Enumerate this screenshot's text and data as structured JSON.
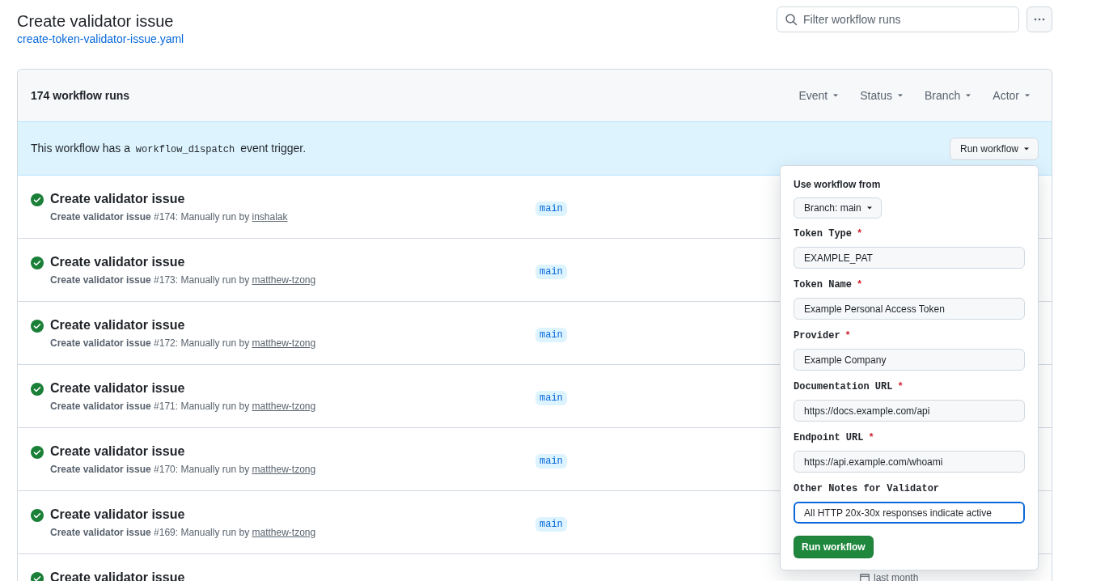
{
  "page": {
    "title": "Create validator issue",
    "file_link": "create-token-validator-issue.yaml",
    "filter": {
      "placeholder": "Filter workflow runs"
    }
  },
  "runs_box": {
    "count": "174 workflow runs",
    "filters": [
      "Event",
      "Status",
      "Branch",
      "Actor"
    ],
    "banner": {
      "before": "This workflow has a",
      "code": "workflow_dispatch",
      "after": "event trigger.",
      "button": "Run workflow"
    },
    "runs": [
      {
        "succeeded": true,
        "title": "Create validator issue",
        "workflow": "Create validator issue",
        "number": "#174: Manually run by",
        "actor": "inshalak",
        "branch": "main"
      },
      {
        "succeeded": true,
        "title": "Create validator issue",
        "workflow": "Create validator issue",
        "number": "#173: Manually run by",
        "actor": "matthew-tzong",
        "branch": "main"
      },
      {
        "succeeded": true,
        "title": "Create validator issue",
        "workflow": "Create validator issue",
        "number": "#172: Manually run by",
        "actor": "matthew-tzong",
        "branch": "main"
      },
      {
        "succeeded": true,
        "title": "Create validator issue",
        "workflow": "Create validator issue",
        "number": "#171: Manually run by",
        "actor": "matthew-tzong",
        "branch": "main"
      },
      {
        "succeeded": true,
        "title": "Create validator issue",
        "workflow": "Create validator issue",
        "number": "#170: Manually run by",
        "actor": "matthew-tzong",
        "branch": "main"
      },
      {
        "succeeded": true,
        "title": "Create validator issue",
        "workflow": "Create validator issue",
        "number": "#169: Manually run by",
        "actor": "matthew-tzong",
        "branch": "main"
      },
      {
        "succeeded": true,
        "title": "Create validator issue",
        "time": "last month"
      }
    ]
  },
  "run_popover": {
    "heading": "Use workflow from",
    "branch_button": "Branch: main",
    "fields": [
      {
        "label": "Token Type",
        "required_mark": "*",
        "value": "EXAMPLE_PAT",
        "focused": false
      },
      {
        "label": "Token Name",
        "required_mark": "*",
        "value": "Example Personal Access Token",
        "focused": false
      },
      {
        "label": "Provider",
        "required_mark": "*",
        "value": "Example Company",
        "focused": false
      },
      {
        "label": "Documentation URL",
        "required_mark": "*",
        "value": "https://docs.example.com/api",
        "focused": false
      },
      {
        "label": "Endpoint URL",
        "required_mark": "*",
        "value": "https://api.example.com/whoami",
        "focused": false
      },
      {
        "label": "Other Notes for Validator",
        "value": "All HTTP 20x-30x responses indicate active",
        "focused": true
      }
    ],
    "submit": "Run workflow"
  }
}
